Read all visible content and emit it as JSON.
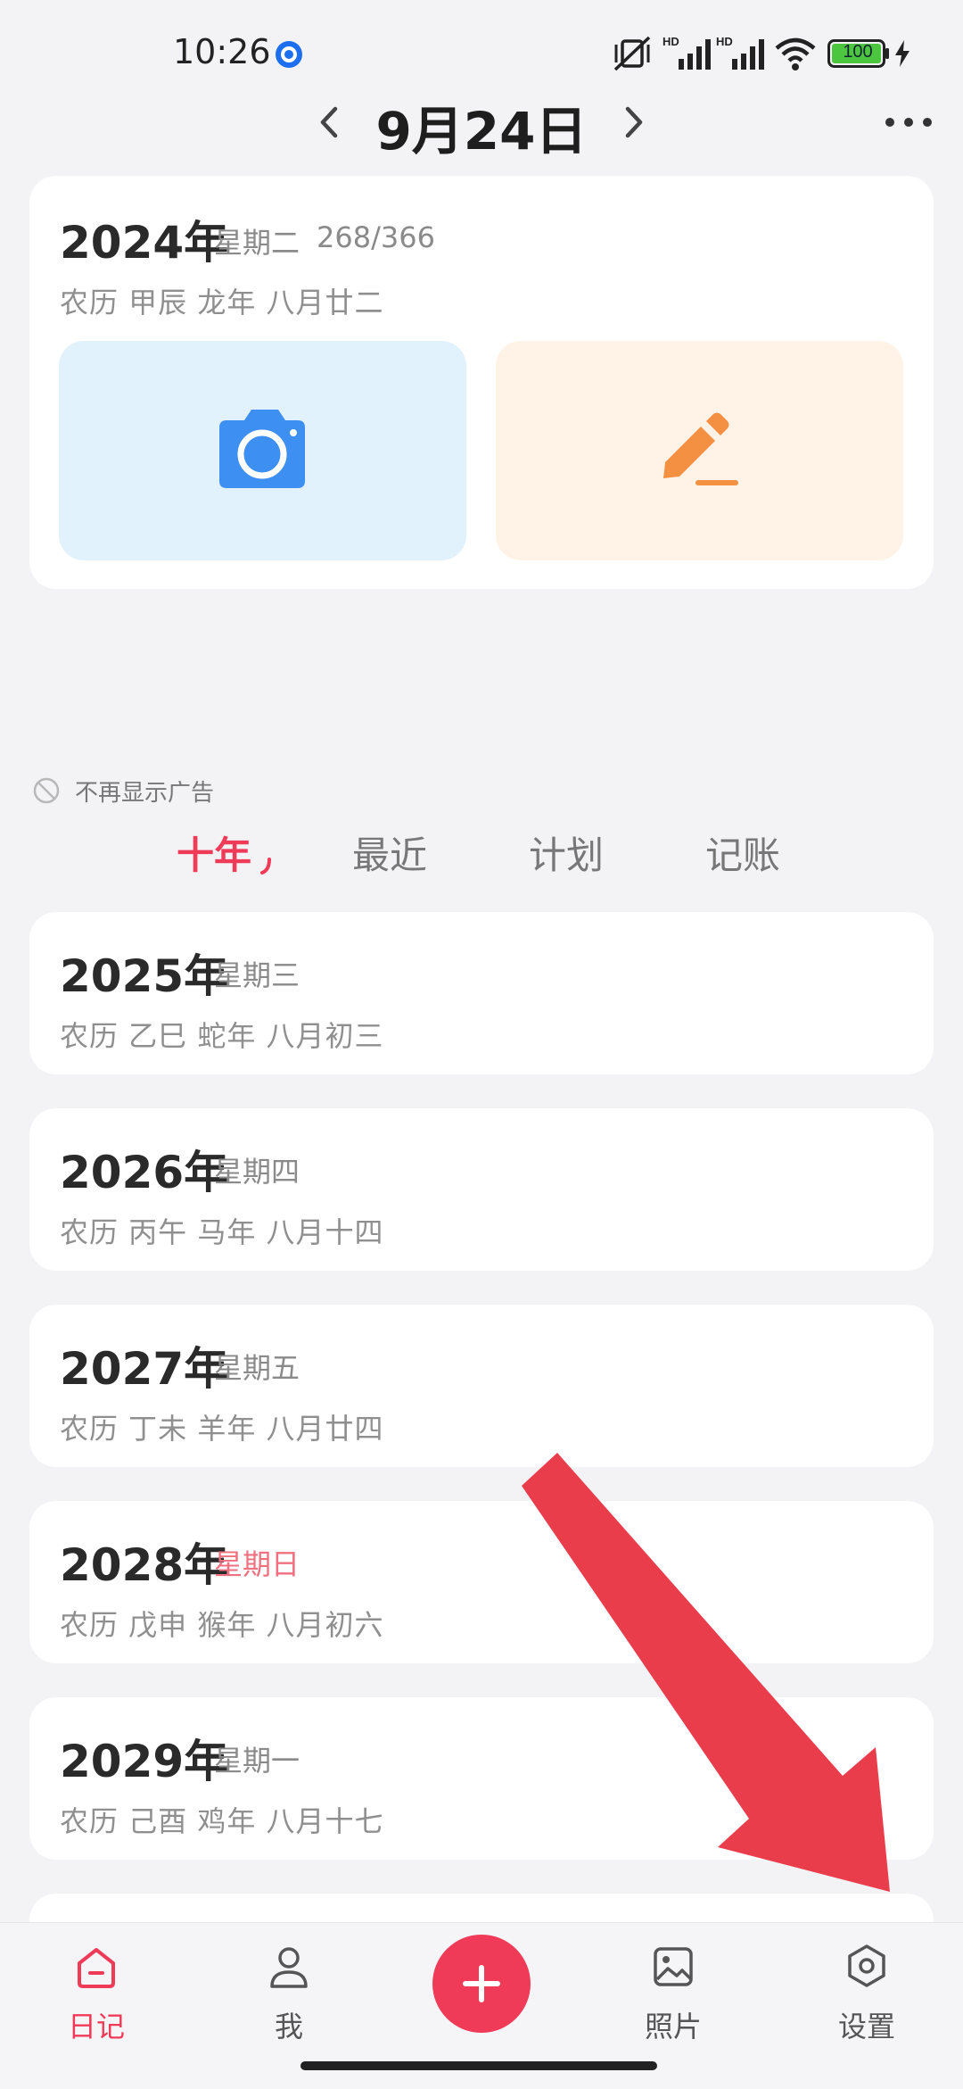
{
  "status_bar": {
    "time": "10:26",
    "battery": "100",
    "hd1": "HD",
    "hd2": "HD"
  },
  "header": {
    "date": "9月24日"
  },
  "today_card": {
    "year": "2024年",
    "weekday": "星期二",
    "day_of_year": "268/366",
    "lunar": "农历  甲辰 龙年 八月廿二"
  },
  "ad_notice": "不再显示广告",
  "tabs": [
    "十年",
    "最近",
    "计划",
    "记账"
  ],
  "years": [
    {
      "year": "2025年",
      "weekday": "星期三",
      "lunar": "农历  乙巳 蛇年 八月初三"
    },
    {
      "year": "2026年",
      "weekday": "星期四",
      "lunar": "农历  丙午 马年 八月十四"
    },
    {
      "year": "2027年",
      "weekday": "星期五",
      "lunar": "农历  丁未 羊年 八月廿四"
    },
    {
      "year": "2028年",
      "weekday": "星期日",
      "lunar": "农历  戊申 猴年 八月初六"
    },
    {
      "year": "2029年",
      "weekday": "星期一",
      "lunar": "农历  己酉 鸡年 八月十七"
    }
  ],
  "bottom_nav": {
    "diary": "日记",
    "me": "我",
    "photos": "照片",
    "settings": "设置"
  },
  "colors": {
    "accent": "#f03b58",
    "camera_bg": "#e2f2fd",
    "pen_bg": "#fff3e8",
    "camera_icon": "#3d8ff2",
    "pen_icon": "#f49042",
    "arrow": "#ea3d4c"
  }
}
